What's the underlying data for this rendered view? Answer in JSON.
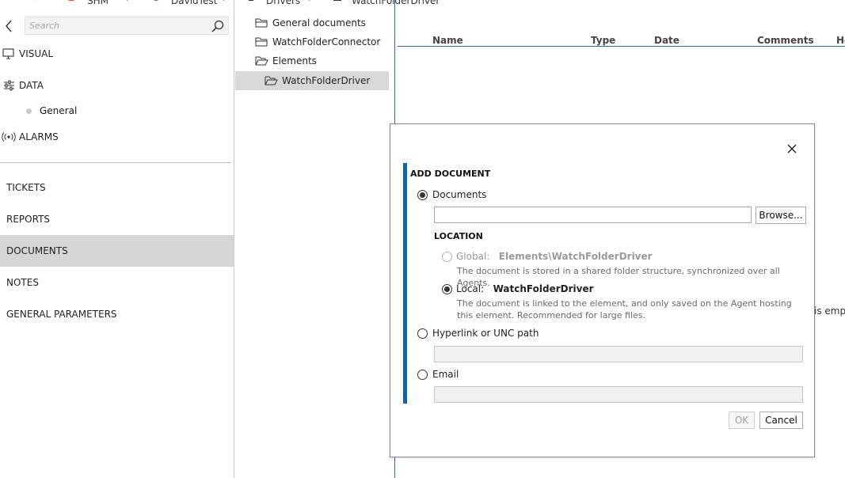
{
  "breadcrumb": [
    {
      "label": "SHM"
    },
    {
      "label": "DavidTest"
    },
    {
      "label": "Drivers"
    },
    {
      "label": "WatchFolderDriver"
    }
  ],
  "search": {
    "placeholder": "Search"
  },
  "nav": {
    "visual": "VISUAL",
    "data": "DATA",
    "general": "General",
    "alarms": "ALARMS"
  },
  "sections": [
    "TICKETS",
    "REPORTS",
    "DOCUMENTS",
    "NOTES",
    "GENERAL PARAMETERS"
  ],
  "active_section": "DOCUMENTS",
  "tree": {
    "items": [
      "General documents",
      "WatchFolderConnector",
      "Elements",
      "WatchFolderDriver"
    ],
    "selected": "WatchFolderDriver"
  },
  "list": {
    "columns": [
      "Name",
      "Type",
      "Date",
      "Comments",
      "He"
    ],
    "empty_fragment": "is empt"
  },
  "dialog": {
    "title": "ADD DOCUMENT",
    "documents_label": "Documents",
    "documents_value": "",
    "browse_label": "Browse...",
    "location_heading": "LOCATION",
    "global_label": "Global:",
    "global_path": "Elements\\WatchFolderDriver",
    "global_desc": "The document is stored in a shared folder structure, synchronized over all Agents.",
    "local_label": "Local:",
    "local_path": "WatchFolderDriver",
    "local_desc": "The document is linked to the element, and only saved on the Agent hosting this element. Recommended for large files.",
    "hyperlink_label": "Hyperlink or UNC path",
    "hyperlink_value": "",
    "email_label": "Email",
    "email_value": "",
    "ok_label": "OK",
    "cancel_label": "Cancel"
  }
}
